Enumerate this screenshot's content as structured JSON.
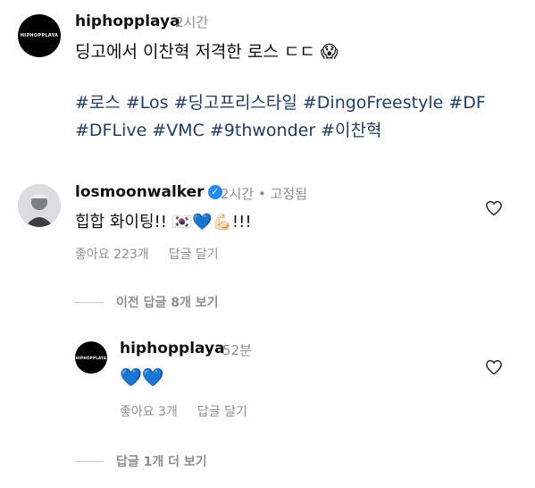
{
  "post": {
    "username": "hiphopplaya",
    "time": "2시간",
    "avatar_text": "HIPHOPPLAYA",
    "caption": "딩고에서 이찬혁 저격한 로스 ㄷㄷ 😱",
    "hashtags": [
      "#로스",
      "#Los",
      "#딩고프리스타일",
      "#DingoFreestyle",
      "#DF",
      "#DFLive",
      "#VMC",
      "#9thwonder",
      "#이찬혁"
    ]
  },
  "comment": {
    "username": "losmoonwalker",
    "verified": true,
    "time": "2시간",
    "pinned": "고정됨",
    "text": "힙합 화이팅!! 🇰🇷💙💪🏻!!!",
    "likes": "좋아요 223개",
    "reply_label": "답글 달기",
    "view_prev": "이전 답글 8개 보기"
  },
  "reply": {
    "username": "hiphopplaya",
    "time": "52분",
    "avatar_text": "HIPHOPPLAYA",
    "text": "💙💙",
    "likes": "좋아요 3개",
    "reply_label": "답글 달기",
    "view_more": "답글 1개 더 보기"
  },
  "colors": {
    "hashtag": "#1d3d6a",
    "muted": "#8e8e8e",
    "verified": "#1d8cf8"
  }
}
